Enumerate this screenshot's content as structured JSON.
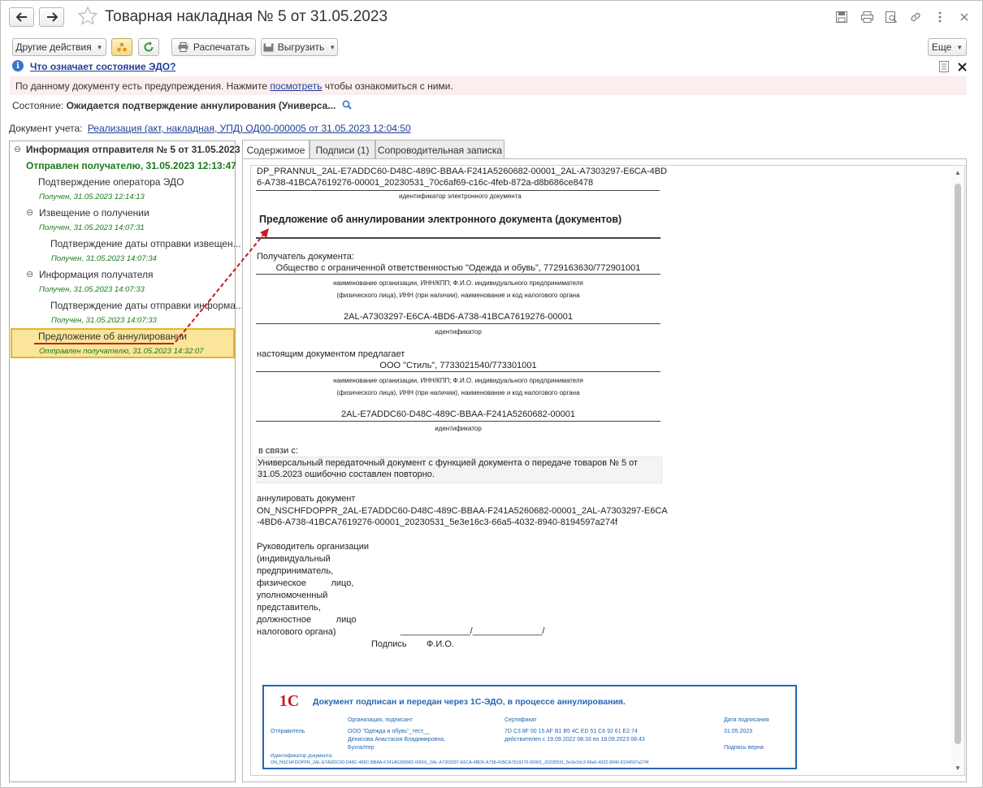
{
  "window": {
    "title": "Товарная накладная № 5 от 31.05.2023"
  },
  "toolbar": {
    "other_actions": "Другие действия",
    "print": "Распечатать",
    "export": "Выгрузить",
    "more": "Еще"
  },
  "edo_help_link": "Что означает состояние ЭДО?",
  "warning": {
    "before": "По данному документу есть предупреждения. Нажмите ",
    "link": "посмотреть",
    "after": " чтобы ознакомиться с ними."
  },
  "state": {
    "label": "Состояние:",
    "value": "Ожидается подтверждение аннулирования (Универса..."
  },
  "accounting_doc": {
    "label": "Документ учета:",
    "link": "Реализация (акт, накладная, УПД) ОД00-000005 от 31.05.2023 12:04:50"
  },
  "tree": {
    "root": "Информация отправителя № 5 от 31.05.2023",
    "root_status": "Отправлен получателю, 31.05.2023 12:13:47",
    "items": [
      {
        "label": "Подтверждение оператора ЭДО",
        "status": "Получен, 31.05.2023 12:14:13"
      },
      {
        "label": "Извещение о получении",
        "status": "Получен, 31.05.2023 14:07:31"
      },
      {
        "label": "Подтверждение даты отправки извещен...",
        "status": "Получен, 31.05.2023 14:07:34"
      },
      {
        "label": "Информация получателя",
        "status": "Получен, 31.05.2023 14:07:33"
      },
      {
        "label": "Подтверждение даты отправки информа...",
        "status": "Получен, 31.05.2023 14:07:33"
      },
      {
        "label": "Предложение об аннулировании",
        "status": "Отправлен получателю, 31.05.2023 14:32:07"
      }
    ]
  },
  "tabs": [
    "Содержимое",
    "Подписи (1)",
    "Сопроводительная записка"
  ],
  "document": {
    "file_id_1": "DP_PRANNUL_2AL-E7ADDC60-D48C-489C-BBAA-F241A5260682-00001_2AL-A7303297-E6CA-4BD",
    "file_id_2": "6-A738-41BCA7619276-00001_20230531_70c6af69-c16c-4feb-872a-d8b686ce8478",
    "file_id_caption": "идентификатор электронного документа",
    "heading": "Предложение об аннулировании электронного документа (документов)",
    "recipient_label": "Получатель документа:",
    "recipient": "Общество с ограниченной ответственностью \"Одежда и обувь\", 7729163630/772901001",
    "org_caption_1": "наименование организации, ИНН/КПП; Ф.И.О. индивидуального предпринимателя",
    "org_caption_2": "(физического лица), ИНН (при наличии), наименование и код налогового органа",
    "recipient_id": "2AL-A7303297-E6CA-4BD6-A738-41BCA7619276-00001",
    "id_caption": "идентификатор",
    "proposes_label": "настоящим документом предлагает",
    "sender": "ООО \"Стиль\", 7733021540/773301001",
    "sender_id": "2AL-E7ADDC60-D48C-489C-BBAA-F241A5260682-00001",
    "reason_label": "в связи с:",
    "reason_1": "Универсальный передаточный документ с функцией документа о передаче товаров  № 5 от",
    "reason_2": "31.05.2023 ошибочно составлен повторно.",
    "annul_label": "аннулировать документ",
    "annul_id_1": "ON_NSCHFDOPPR_2AL-E7ADDC60-D48C-489C-BBAA-F241A5260682-00001_2AL-A7303297-E6CA",
    "annul_id_2": "-4BD6-A738-41BCA7619276-00001_20230531_5e3e16c3-66a5-4032-8940-8194597a274f",
    "head_lines": [
      "Руководитель  организации",
      "(индивидуальный",
      "предприниматель,",
      "физическое          лицо,",
      "уполномоченный",
      "представитель,",
      "должностное          лицо",
      "налогового органа)"
    ],
    "sign_line": "______________/______________/",
    "sign_caption": "Подпись        Ф.И.О."
  },
  "stamp": {
    "logo": "1С",
    "title": "Документ подписан и передан через 1С-ЭДО, в процессе аннулирования.",
    "col_org": "Организация, подписант",
    "col_cert": "Сертификат",
    "col_date": "Дата подписания",
    "role": "Отправитель",
    "org": "ООО \"Одежда и обувь\"_тест__",
    "signer": "Денисова Анастасия Владимировна,",
    "position": "Бухгалтер",
    "cert": "7D C3 8F 00 15 AF B1 B5 4C ED 51 C6 92 61 E2 74",
    "cert_valid": "действителен с 19.09.2022 08:33 по 19.09.2023 08:43",
    "date": "31.05.2023",
    "verified": "Подпись верна",
    "doc_id_label": "Идентификатор документа:",
    "doc_id": "ON_NSCHFDOPPR_2AL-E7ADDC60-D48C-489C-BBAA-F241A5260682-00001_2AL-A7303297-E6CA-4BD6-A738-41BCA7619276-00001_20230531_5e3e16c3-66a5-4032-8940-8194597a274f"
  },
  "colors": {
    "link": "#1c3f94",
    "status_green": "#1a7a1a",
    "selection": "#fbe59a",
    "stamp_blue": "#2366b2",
    "arrow": "#c81e1e"
  }
}
